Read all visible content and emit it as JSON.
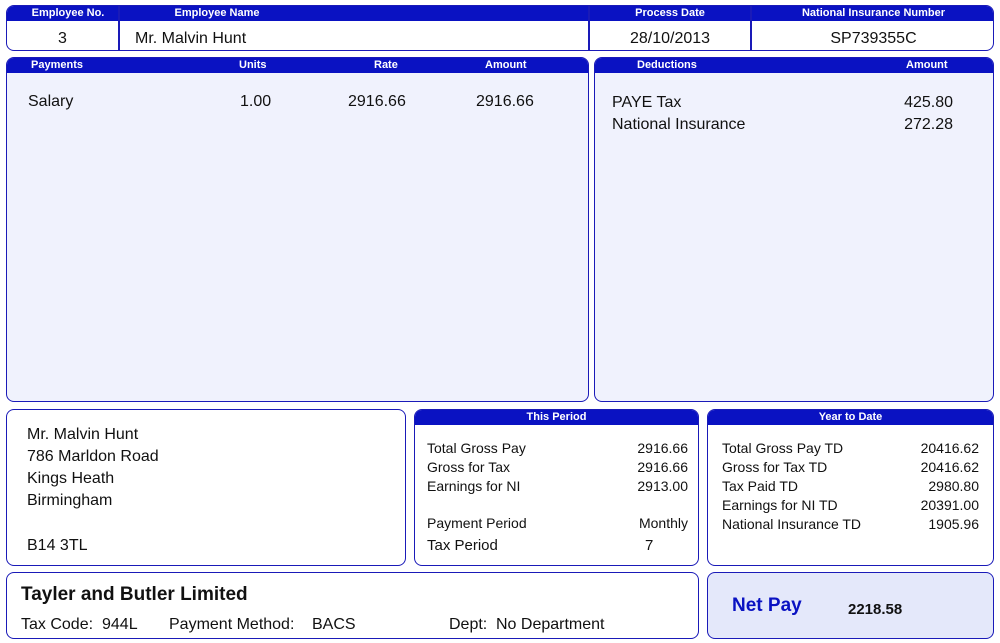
{
  "employee": {
    "no_label": "Employee No.",
    "no": "3",
    "name_label": "Employee Name",
    "name": "Mr. Malvin Hunt",
    "process_date_label": "Process Date",
    "process_date": "28/10/2013",
    "ni_label": "National Insurance Number",
    "ni_number": "SP739355C"
  },
  "payments": {
    "headers": {
      "payments": "Payments",
      "units": "Units",
      "rate": "Rate",
      "amount": "Amount"
    },
    "rows": [
      {
        "description": "Salary",
        "units": "1.00",
        "rate": "2916.66",
        "amount": "2916.66"
      }
    ]
  },
  "deductions": {
    "headers": {
      "deductions": "Deductions",
      "amount": "Amount"
    },
    "rows": [
      {
        "description": "PAYE Tax",
        "amount": "425.80"
      },
      {
        "description": "National Insurance",
        "amount": "272.28"
      }
    ]
  },
  "address": {
    "lines": [
      "Mr. Malvin Hunt",
      "786 Marldon Road",
      "Kings Heath",
      "Birmingham"
    ],
    "postcode": "B14 3TL"
  },
  "this_period": {
    "title": "This Period",
    "rows": [
      {
        "label": "Total Gross Pay",
        "value": "2916.66"
      },
      {
        "label": "Gross for Tax",
        "value": "2916.66"
      },
      {
        "label": "Earnings for NI",
        "value": "2913.00"
      }
    ],
    "payment_period_label": "Payment Period",
    "payment_period": "Monthly",
    "tax_period_label": "Tax Period",
    "tax_period": "7"
  },
  "year_to_date": {
    "title": "Year to Date",
    "rows": [
      {
        "label": "Total Gross Pay TD",
        "value": "20416.62"
      },
      {
        "label": "Gross for Tax TD",
        "value": "20416.62"
      },
      {
        "label": "Tax Paid TD",
        "value": "2980.80"
      },
      {
        "label": "Earnings for NI TD",
        "value": "20391.00"
      },
      {
        "label": "National Insurance TD",
        "value": "1905.96"
      }
    ]
  },
  "company": {
    "name": "Tayler and Butler Limited",
    "tax_code_label": "Tax Code:",
    "tax_code": "944L",
    "payment_method_label": "Payment Method:",
    "payment_method": "BACS",
    "dept_label": "Dept:",
    "dept": "No Department"
  },
  "net_pay": {
    "label": "Net Pay",
    "value": "2218.58"
  },
  "colors": {
    "header_blue": "#0a12c2",
    "panel_fill": "#f0f2fd",
    "net_pay_text": "#0a12c2"
  }
}
